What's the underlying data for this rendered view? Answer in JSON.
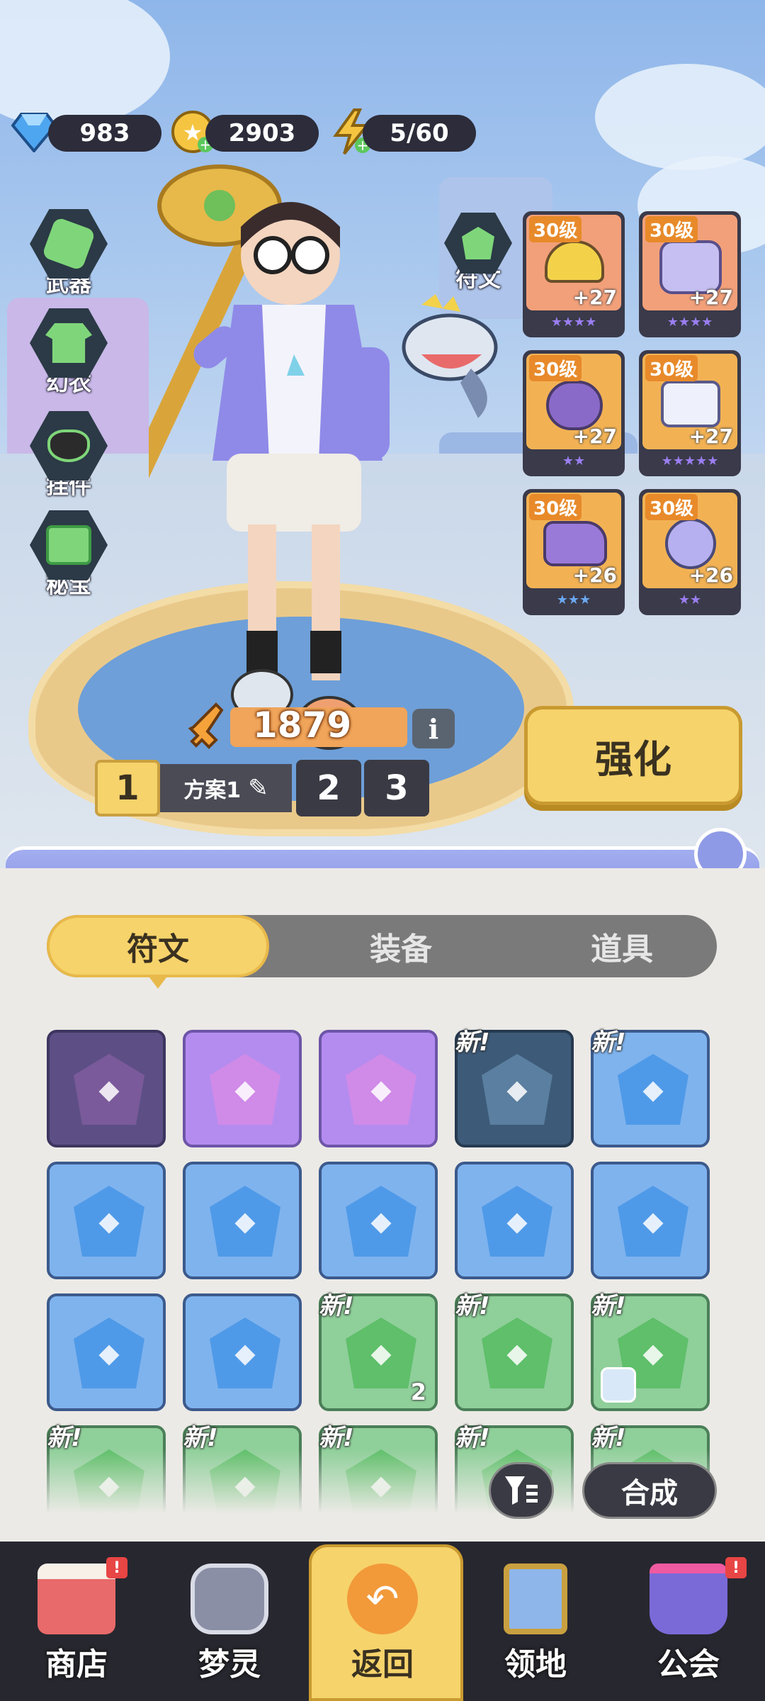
{
  "top_bar": {
    "gems": "983",
    "gold": "2903",
    "energy": "5/60",
    "gem_icon": "diamond-icon",
    "gold_icon": "coin-icon",
    "energy_icon": "lightning-icon"
  },
  "side_menu": [
    {
      "label": "武器",
      "icon": "weapon-icon"
    },
    {
      "label": "幻衣",
      "icon": "shirt-icon"
    },
    {
      "label": "挂件",
      "icon": "pendant-icon"
    },
    {
      "label": "秘宝",
      "icon": "treasure-icon"
    }
  ],
  "rune_button": {
    "label": "符文",
    "icon": "rune-icon"
  },
  "equipment": [
    {
      "level": "30级",
      "plus": "+27",
      "stars": "★★★★",
      "slot": "helmet"
    },
    {
      "level": "30级",
      "plus": "+27",
      "stars": "★★★★",
      "slot": "armor"
    },
    {
      "level": "30级",
      "plus": "+27",
      "stars": "★★",
      "slot": "bracer"
    },
    {
      "level": "30级",
      "plus": "+27",
      "stars": "★★★★★",
      "slot": "pants"
    },
    {
      "level": "30级",
      "plus": "+26",
      "stars": "★★★",
      "slot": "boots"
    },
    {
      "level": "30级",
      "plus": "+26",
      "stars": "★★",
      "slot": "orb"
    }
  ],
  "power": {
    "value": "1879",
    "info_icon": "info-icon",
    "sword_icon": "sword-icon"
  },
  "loadouts": {
    "slot1": "1",
    "plan_label": "方案1",
    "slot2": "2",
    "slot3": "3",
    "edit_icon": "edit-icon"
  },
  "enhance_button": "强化",
  "tabs": [
    {
      "label": "符文",
      "active": true
    },
    {
      "label": "装备",
      "active": false
    },
    {
      "label": "道具",
      "active": false
    }
  ],
  "inventory": [
    {
      "color": "purple-dark",
      "new": "",
      "count": ""
    },
    {
      "color": "purple",
      "new": "",
      "count": ""
    },
    {
      "color": "purple",
      "new": "",
      "count": ""
    },
    {
      "color": "navy",
      "new": "新!",
      "count": ""
    },
    {
      "color": "blue",
      "new": "新!",
      "count": ""
    },
    {
      "color": "blue",
      "new": "",
      "count": ""
    },
    {
      "color": "blue",
      "new": "",
      "count": ""
    },
    {
      "color": "blue",
      "new": "",
      "count": ""
    },
    {
      "color": "blue",
      "new": "",
      "count": ""
    },
    {
      "color": "blue",
      "new": "",
      "count": ""
    },
    {
      "color": "blue",
      "new": "",
      "count": ""
    },
    {
      "color": "blue",
      "new": "",
      "count": ""
    },
    {
      "color": "green",
      "new": "新!",
      "count": "2"
    },
    {
      "color": "green",
      "new": "新!",
      "count": ""
    },
    {
      "color": "green",
      "new": "新!",
      "count": ""
    },
    {
      "color": "green",
      "new": "新!",
      "count": ""
    },
    {
      "color": "green",
      "new": "新!",
      "count": ""
    },
    {
      "color": "green",
      "new": "新!",
      "count": ""
    },
    {
      "color": "green",
      "new": "新!",
      "count": ""
    },
    {
      "color": "green",
      "new": "新!",
      "count": ""
    }
  ],
  "filter_icon": "filter-icon",
  "synthesize_button": "合成",
  "bottom_nav": [
    {
      "label": "商店",
      "icon": "shop-icon",
      "badge": "!"
    },
    {
      "label": "梦灵",
      "icon": "spirit-icon",
      "badge": ""
    },
    {
      "label": "返回",
      "icon": "return-icon",
      "badge": ""
    },
    {
      "label": "领地",
      "icon": "territory-icon",
      "badge": ""
    },
    {
      "label": "公会",
      "icon": "guild-icon",
      "badge": "!"
    }
  ],
  "colors": {
    "accent_yellow": "#f6d36b",
    "dark_bar": "#2c2c3a",
    "rune_purple": "#b48cf0",
    "rune_blue": "#7fb3ee",
    "rune_green": "#8fcf9a",
    "orange_level": "#e88a2a"
  }
}
